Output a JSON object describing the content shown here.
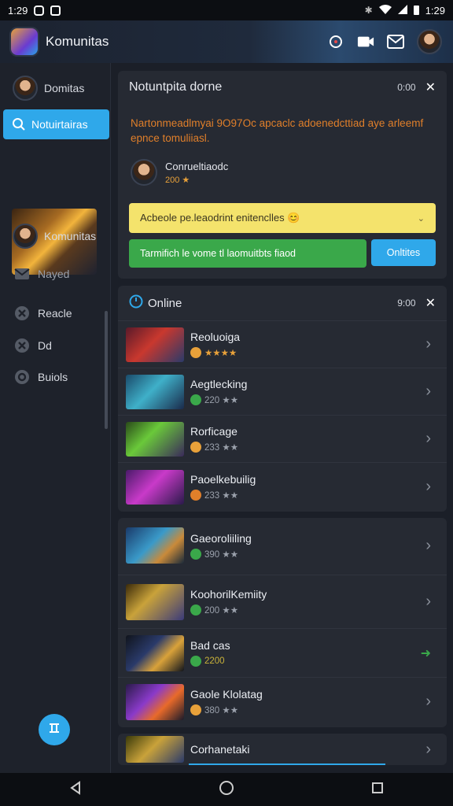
{
  "status": {
    "time": "1:29",
    "right_time": "1:29"
  },
  "app": {
    "title": "Komunitas"
  },
  "sidebar": {
    "items": [
      {
        "label": "Domitas",
        "icon": "avatar"
      },
      {
        "label": "Notuirtairas",
        "icon": "search-icon"
      },
      {
        "label": "Komunitas",
        "icon": "avatar"
      },
      {
        "label": "Nayed",
        "icon": "mail-icon"
      },
      {
        "label": "Reacle",
        "icon": "cross-icon"
      },
      {
        "label": "Dd",
        "icon": "close-box-icon"
      },
      {
        "label": "Buiols",
        "icon": "circle-icon"
      }
    ]
  },
  "notification": {
    "title": "Notuntpita dorne",
    "time": "0:00",
    "message": "Nartonmeadlmyai 9O97Oc apcaclc adoenedcttiad aye arleemf epnce tomuliiasl.",
    "user_name": "Conrueltiaodc",
    "user_rating": "200 ★",
    "info_text": "Acbeole  pe.leaodrint enitenclles 😊",
    "button_primary": "Tarmifich le vome tl laomuitbts fiaod",
    "button_secondary": "Onltites"
  },
  "online": {
    "title": "Online",
    "time": "9:00",
    "items": [
      {
        "title": "Reoluoiga",
        "meta": "★★★★",
        "badge": "#e8a13a"
      },
      {
        "title": "Aegtlecking",
        "meta": "220 ★★",
        "badge": "#3aa84a"
      },
      {
        "title": "Rorficage",
        "meta": "233 ★★",
        "badge": "#e8a13a"
      },
      {
        "title": "Paoelkebuilig",
        "meta": "233 ★★",
        "badge": "#e07f2a"
      }
    ]
  },
  "list2": {
    "items": [
      {
        "title": "Gaeoroliiling",
        "meta": "390 ★★",
        "badge": "#3aa84a"
      },
      {
        "title": "KoohorilKemiity",
        "meta": "200 ★★",
        "badge": "#3aa84a"
      },
      {
        "title": "Bad cas",
        "meta": "2200",
        "badge": "#3aa84a"
      },
      {
        "title": "Gaole Klolatag",
        "meta": "380 ★★",
        "badge": "#e8a13a"
      }
    ]
  },
  "last_item": {
    "title": "Corhanetaki"
  },
  "colors": {
    "accent": "#2fa8ea",
    "green": "#3aa84a",
    "yellow": "#f7e26b",
    "orange": "#e07f2a"
  }
}
